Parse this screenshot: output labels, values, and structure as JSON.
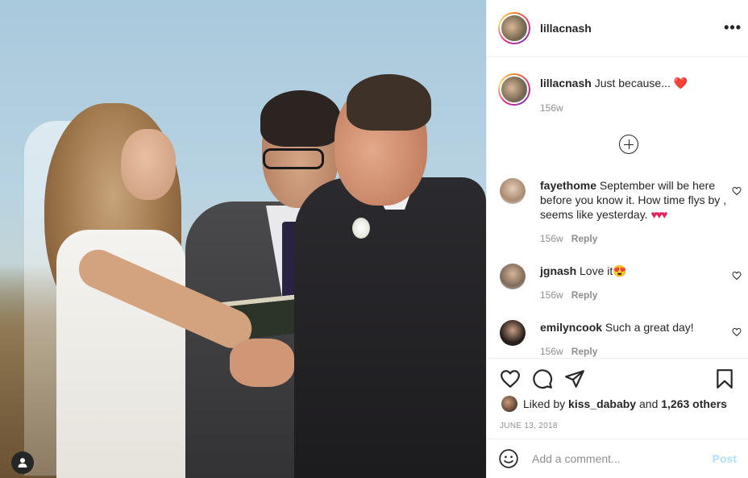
{
  "post": {
    "username": "lillacnash",
    "caption_text": "Just because...",
    "caption_emoji": "❤️",
    "caption_time": "156w",
    "more_icon": "more-horizontal-icon"
  },
  "comments": [
    {
      "username": "fayethome",
      "text": "September will be here before you know it. How time flys by , seems like yesterday.",
      "emoji": "♥♥♥",
      "time": "156w",
      "reply": "Reply"
    },
    {
      "username": "jgnash",
      "text": "Love it",
      "emoji": "😍",
      "time": "156w",
      "reply": "Reply"
    },
    {
      "username": "emilyncook",
      "text": "Such a great day!",
      "emoji": "",
      "time": "156w",
      "reply": "Reply"
    }
  ],
  "actions": {
    "liked_prefix": "Liked by",
    "liked_user": "kiss_dababy",
    "liked_and": "and",
    "liked_others": "1,263 others",
    "date": "JUNE 13, 2018"
  },
  "add_comment": {
    "placeholder": "Add a comment...",
    "post_label": "Post"
  },
  "colors": {
    "post_button": "#b2dffc",
    "heart": "#e0245e",
    "muted": "#8e8e8e"
  }
}
